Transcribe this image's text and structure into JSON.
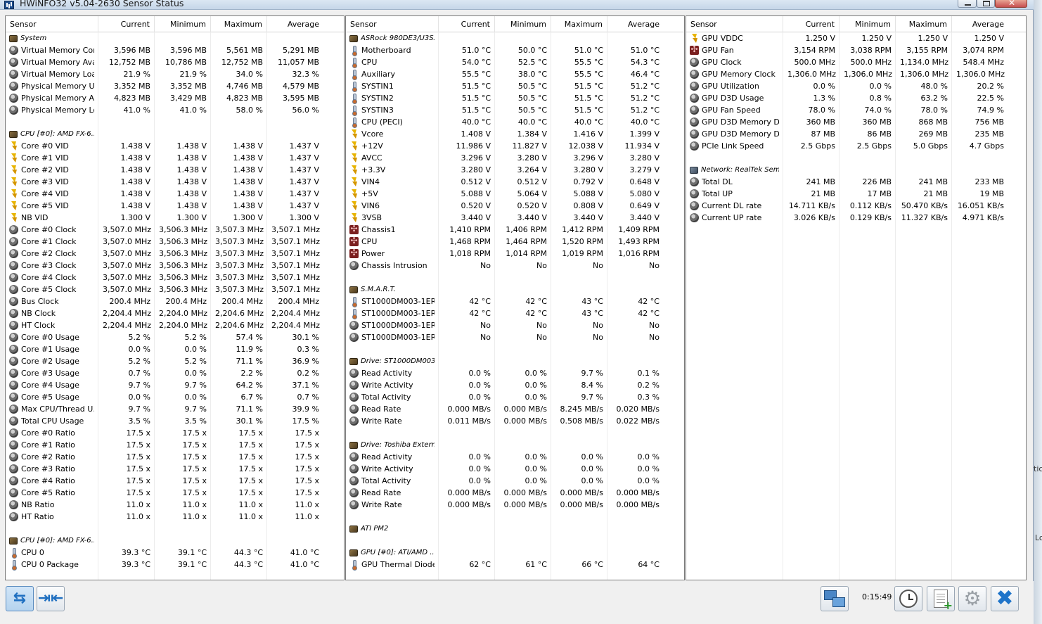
{
  "window": {
    "title": "HWiNFO32 v5.04-2630 Sensor Status"
  },
  "columns": [
    "Sensor",
    "Current",
    "Minimum",
    "Maximum",
    "Average"
  ],
  "panels": [
    {
      "rows": [
        {
          "t": "g",
          "icon": "chip",
          "n": "System"
        },
        {
          "icon": "gauge",
          "n": "Virtual Memory Com...",
          "v": [
            "3,596 MB",
            "3,596 MB",
            "5,561 MB",
            "5,291 MB"
          ]
        },
        {
          "icon": "gauge",
          "n": "Virtual Memory Avai...",
          "v": [
            "12,752 MB",
            "10,786 MB",
            "12,752 MB",
            "11,057 MB"
          ]
        },
        {
          "icon": "gauge",
          "n": "Virtual Memory Load",
          "v": [
            "21.9 %",
            "21.9 %",
            "34.0 %",
            "32.3 %"
          ]
        },
        {
          "icon": "gauge",
          "n": "Physical Memory Used",
          "v": [
            "3,352 MB",
            "3,352 MB",
            "4,746 MB",
            "4,579 MB"
          ]
        },
        {
          "icon": "gauge",
          "n": "Physical Memory Av...",
          "v": [
            "4,823 MB",
            "3,429 MB",
            "4,823 MB",
            "3,595 MB"
          ]
        },
        {
          "icon": "gauge",
          "n": "Physical Memory Load",
          "v": [
            "41.0 %",
            "41.0 %",
            "58.0 %",
            "56.0 %"
          ]
        },
        {
          "t": "b"
        },
        {
          "t": "g",
          "icon": "chip",
          "n": "CPU [#0]: AMD FX-6..."
        },
        {
          "icon": "volt",
          "n": "Core #0 VID",
          "v": [
            "1.438 V",
            "1.438 V",
            "1.438 V",
            "1.437 V"
          ]
        },
        {
          "icon": "volt",
          "n": "Core #1 VID",
          "v": [
            "1.438 V",
            "1.438 V",
            "1.438 V",
            "1.437 V"
          ]
        },
        {
          "icon": "volt",
          "n": "Core #2 VID",
          "v": [
            "1.438 V",
            "1.438 V",
            "1.438 V",
            "1.437 V"
          ]
        },
        {
          "icon": "volt",
          "n": "Core #3 VID",
          "v": [
            "1.438 V",
            "1.438 V",
            "1.438 V",
            "1.437 V"
          ]
        },
        {
          "icon": "volt",
          "n": "Core #4 VID",
          "v": [
            "1.438 V",
            "1.438 V",
            "1.438 V",
            "1.437 V"
          ]
        },
        {
          "icon": "volt",
          "n": "Core #5 VID",
          "v": [
            "1.438 V",
            "1.438 V",
            "1.438 V",
            "1.437 V"
          ]
        },
        {
          "icon": "volt",
          "n": "NB VID",
          "v": [
            "1.300 V",
            "1.300 V",
            "1.300 V",
            "1.300 V"
          ]
        },
        {
          "icon": "gauge",
          "n": "Core #0 Clock",
          "v": [
            "3,507.0 MHz",
            "3,506.3 MHz",
            "3,507.3 MHz",
            "3,507.1 MHz"
          ]
        },
        {
          "icon": "gauge",
          "n": "Core #1 Clock",
          "v": [
            "3,507.0 MHz",
            "3,506.3 MHz",
            "3,507.3 MHz",
            "3,507.1 MHz"
          ]
        },
        {
          "icon": "gauge",
          "n": "Core #2 Clock",
          "v": [
            "3,507.0 MHz",
            "3,506.3 MHz",
            "3,507.3 MHz",
            "3,507.1 MHz"
          ]
        },
        {
          "icon": "gauge",
          "n": "Core #3 Clock",
          "v": [
            "3,507.0 MHz",
            "3,506.3 MHz",
            "3,507.3 MHz",
            "3,507.1 MHz"
          ]
        },
        {
          "icon": "gauge",
          "n": "Core #4 Clock",
          "v": [
            "3,507.0 MHz",
            "3,506.3 MHz",
            "3,507.3 MHz",
            "3,507.1 MHz"
          ]
        },
        {
          "icon": "gauge",
          "n": "Core #5 Clock",
          "v": [
            "3,507.0 MHz",
            "3,506.3 MHz",
            "3,507.3 MHz",
            "3,507.1 MHz"
          ]
        },
        {
          "icon": "gauge",
          "n": "Bus Clock",
          "v": [
            "200.4 MHz",
            "200.4 MHz",
            "200.4 MHz",
            "200.4 MHz"
          ]
        },
        {
          "icon": "gauge",
          "n": "NB Clock",
          "v": [
            "2,204.4 MHz",
            "2,204.0 MHz",
            "2,204.6 MHz",
            "2,204.4 MHz"
          ]
        },
        {
          "icon": "gauge",
          "n": "HT Clock",
          "v": [
            "2,204.4 MHz",
            "2,204.0 MHz",
            "2,204.6 MHz",
            "2,204.4 MHz"
          ]
        },
        {
          "icon": "gauge",
          "n": "Core #0 Usage",
          "v": [
            "5.2 %",
            "5.2 %",
            "57.4 %",
            "30.1 %"
          ]
        },
        {
          "icon": "gauge",
          "n": "Core #1 Usage",
          "v": [
            "0.0 %",
            "0.0 %",
            "11.9 %",
            "0.3 %"
          ]
        },
        {
          "icon": "gauge",
          "n": "Core #2 Usage",
          "v": [
            "5.2 %",
            "5.2 %",
            "71.1 %",
            "36.9 %"
          ]
        },
        {
          "icon": "gauge",
          "n": "Core #3 Usage",
          "v": [
            "0.7 %",
            "0.0 %",
            "2.2 %",
            "0.2 %"
          ]
        },
        {
          "icon": "gauge",
          "n": "Core #4 Usage",
          "v": [
            "9.7 %",
            "9.7 %",
            "64.2 %",
            "37.1 %"
          ]
        },
        {
          "icon": "gauge",
          "n": "Core #5 Usage",
          "v": [
            "0.0 %",
            "0.0 %",
            "6.7 %",
            "0.7 %"
          ]
        },
        {
          "icon": "gauge",
          "n": "Max CPU/Thread U...",
          "v": [
            "9.7 %",
            "9.7 %",
            "71.1 %",
            "39.9 %"
          ]
        },
        {
          "icon": "gauge",
          "n": "Total CPU Usage",
          "v": [
            "3.5 %",
            "3.5 %",
            "30.1 %",
            "17.5 %"
          ]
        },
        {
          "icon": "gauge",
          "n": "Core #0 Ratio",
          "v": [
            "17.5 x",
            "17.5 x",
            "17.5 x",
            "17.5 x"
          ]
        },
        {
          "icon": "gauge",
          "n": "Core #1 Ratio",
          "v": [
            "17.5 x",
            "17.5 x",
            "17.5 x",
            "17.5 x"
          ]
        },
        {
          "icon": "gauge",
          "n": "Core #2 Ratio",
          "v": [
            "17.5 x",
            "17.5 x",
            "17.5 x",
            "17.5 x"
          ]
        },
        {
          "icon": "gauge",
          "n": "Core #3 Ratio",
          "v": [
            "17.5 x",
            "17.5 x",
            "17.5 x",
            "17.5 x"
          ]
        },
        {
          "icon": "gauge",
          "n": "Core #4 Ratio",
          "v": [
            "17.5 x",
            "17.5 x",
            "17.5 x",
            "17.5 x"
          ]
        },
        {
          "icon": "gauge",
          "n": "Core #5 Ratio",
          "v": [
            "17.5 x",
            "17.5 x",
            "17.5 x",
            "17.5 x"
          ]
        },
        {
          "icon": "gauge",
          "n": "NB Ratio",
          "v": [
            "11.0 x",
            "11.0 x",
            "11.0 x",
            "11.0 x"
          ]
        },
        {
          "icon": "gauge",
          "n": "HT Ratio",
          "v": [
            "11.0 x",
            "11.0 x",
            "11.0 x",
            "11.0 x"
          ]
        },
        {
          "t": "b"
        },
        {
          "t": "g",
          "icon": "chip",
          "n": "CPU [#0]: AMD FX-6..."
        },
        {
          "icon": "therm",
          "n": "CPU 0",
          "v": [
            "39.3 °C",
            "39.1 °C",
            "44.3 °C",
            "41.0 °C"
          ]
        },
        {
          "icon": "therm",
          "n": "CPU 0 Package",
          "v": [
            "39.3 °C",
            "39.1 °C",
            "44.3 °C",
            "41.0 °C"
          ]
        }
      ]
    },
    {
      "rows": [
        {
          "t": "g",
          "icon": "chip",
          "n": "ASRock 980DE3/U3S3..."
        },
        {
          "icon": "therm",
          "n": "Motherboard",
          "v": [
            "51.0 °C",
            "50.0 °C",
            "51.0 °C",
            "51.0 °C"
          ]
        },
        {
          "icon": "therm",
          "n": "CPU",
          "v": [
            "54.0 °C",
            "52.5 °C",
            "55.5 °C",
            "54.3 °C"
          ]
        },
        {
          "icon": "therm",
          "n": "Auxiliary",
          "v": [
            "55.5 °C",
            "38.0 °C",
            "55.5 °C",
            "46.4 °C"
          ]
        },
        {
          "icon": "therm",
          "n": "SYSTIN1",
          "v": [
            "51.5 °C",
            "50.5 °C",
            "51.5 °C",
            "51.2 °C"
          ]
        },
        {
          "icon": "therm",
          "n": "SYSTIN2",
          "v": [
            "51.5 °C",
            "50.5 °C",
            "51.5 °C",
            "51.2 °C"
          ]
        },
        {
          "icon": "therm",
          "n": "SYSTIN3",
          "v": [
            "51.5 °C",
            "50.5 °C",
            "51.5 °C",
            "51.2 °C"
          ]
        },
        {
          "icon": "therm",
          "n": "CPU (PECI)",
          "v": [
            "40.0 °C",
            "40.0 °C",
            "40.0 °C",
            "40.0 °C"
          ]
        },
        {
          "icon": "volt",
          "n": "Vcore",
          "v": [
            "1.408 V",
            "1.384 V",
            "1.416 V",
            "1.399 V"
          ]
        },
        {
          "icon": "volt",
          "n": "+12V",
          "v": [
            "11.986 V",
            "11.827 V",
            "12.038 V",
            "11.934 V"
          ]
        },
        {
          "icon": "volt",
          "n": "AVCC",
          "v": [
            "3.296 V",
            "3.280 V",
            "3.296 V",
            "3.280 V"
          ]
        },
        {
          "icon": "volt",
          "n": "+3.3V",
          "v": [
            "3.280 V",
            "3.264 V",
            "3.280 V",
            "3.279 V"
          ]
        },
        {
          "icon": "volt",
          "n": "VIN4",
          "v": [
            "0.512 V",
            "0.512 V",
            "0.792 V",
            "0.648 V"
          ]
        },
        {
          "icon": "volt",
          "n": "+5V",
          "v": [
            "5.088 V",
            "5.064 V",
            "5.088 V",
            "5.080 V"
          ]
        },
        {
          "icon": "volt",
          "n": "VIN6",
          "v": [
            "0.520 V",
            "0.520 V",
            "0.808 V",
            "0.649 V"
          ]
        },
        {
          "icon": "volt",
          "n": "3VSB",
          "v": [
            "3.440 V",
            "3.440 V",
            "3.440 V",
            "3.440 V"
          ]
        },
        {
          "icon": "fan",
          "n": "Chassis1",
          "v": [
            "1,410 RPM",
            "1,406 RPM",
            "1,412 RPM",
            "1,409 RPM"
          ]
        },
        {
          "icon": "fan",
          "n": "CPU",
          "v": [
            "1,468 RPM",
            "1,464 RPM",
            "1,520 RPM",
            "1,493 RPM"
          ]
        },
        {
          "icon": "fan",
          "n": "Power",
          "v": [
            "1,018 RPM",
            "1,014 RPM",
            "1,019 RPM",
            "1,016 RPM"
          ]
        },
        {
          "icon": "gauge",
          "n": "Chassis Intrusion",
          "v": [
            "No",
            "No",
            "No",
            "No"
          ]
        },
        {
          "t": "b"
        },
        {
          "t": "g",
          "icon": "chip",
          "n": "S.M.A.R.T."
        },
        {
          "icon": "therm",
          "n": "ST1000DM003-1ER1...",
          "v": [
            "42 °C",
            "42 °C",
            "43 °C",
            "42 °C"
          ]
        },
        {
          "icon": "therm",
          "n": "ST1000DM003-1ER1...",
          "v": [
            "42 °C",
            "42 °C",
            "43 °C",
            "42 °C"
          ]
        },
        {
          "icon": "gauge",
          "n": "ST1000DM003-1ER1...",
          "v": [
            "No",
            "No",
            "No",
            "No"
          ]
        },
        {
          "icon": "gauge",
          "n": "ST1000DM003-1ER1...",
          "v": [
            "No",
            "No",
            "No",
            "No"
          ]
        },
        {
          "t": "b"
        },
        {
          "t": "g",
          "icon": "chip",
          "n": "Drive: ST1000DM003-..."
        },
        {
          "icon": "gauge",
          "n": "Read Activity",
          "v": [
            "0.0 %",
            "0.0 %",
            "9.7 %",
            "0.1 %"
          ]
        },
        {
          "icon": "gauge",
          "n": "Write Activity",
          "v": [
            "0.0 %",
            "0.0 %",
            "8.4 %",
            "0.2 %"
          ]
        },
        {
          "icon": "gauge",
          "n": "Total Activity",
          "v": [
            "0.0 %",
            "0.0 %",
            "9.7 %",
            "0.3 %"
          ]
        },
        {
          "icon": "gauge",
          "n": "Read Rate",
          "v": [
            "0.000 MB/s",
            "0.000 MB/s",
            "8.245 MB/s",
            "0.020 MB/s"
          ]
        },
        {
          "icon": "gauge",
          "n": "Write Rate",
          "v": [
            "0.011 MB/s",
            "0.000 MB/s",
            "0.508 MB/s",
            "0.022 MB/s"
          ]
        },
        {
          "t": "b"
        },
        {
          "t": "g",
          "icon": "chip",
          "n": "Drive: Toshiba Extern..."
        },
        {
          "icon": "gauge",
          "n": "Read Activity",
          "v": [
            "0.0 %",
            "0.0 %",
            "0.0 %",
            "0.0 %"
          ]
        },
        {
          "icon": "gauge",
          "n": "Write Activity",
          "v": [
            "0.0 %",
            "0.0 %",
            "0.0 %",
            "0.0 %"
          ]
        },
        {
          "icon": "gauge",
          "n": "Total Activity",
          "v": [
            "0.0 %",
            "0.0 %",
            "0.0 %",
            "0.0 %"
          ]
        },
        {
          "icon": "gauge",
          "n": "Read Rate",
          "v": [
            "0.000 MB/s",
            "0.000 MB/s",
            "0.000 MB/s",
            "0.000 MB/s"
          ]
        },
        {
          "icon": "gauge",
          "n": "Write Rate",
          "v": [
            "0.000 MB/s",
            "0.000 MB/s",
            "0.000 MB/s",
            "0.000 MB/s"
          ]
        },
        {
          "t": "b"
        },
        {
          "t": "g",
          "icon": "chip",
          "n": "ATI PM2"
        },
        {
          "t": "b"
        },
        {
          "t": "g",
          "icon": "chip",
          "n": "GPU [#0]: ATI/AMD ..."
        },
        {
          "icon": "therm",
          "n": "GPU Thermal Diode",
          "v": [
            "62 °C",
            "61 °C",
            "66 °C",
            "64 °C"
          ]
        }
      ]
    },
    {
      "rows": [
        {
          "icon": "volt",
          "n": "GPU VDDC",
          "v": [
            "1.250 V",
            "1.250 V",
            "1.250 V",
            "1.250 V"
          ]
        },
        {
          "icon": "fan",
          "n": "GPU Fan",
          "v": [
            "3,154 RPM",
            "3,038 RPM",
            "3,155 RPM",
            "3,074 RPM"
          ]
        },
        {
          "icon": "gauge",
          "n": "GPU Clock",
          "v": [
            "500.0 MHz",
            "500.0 MHz",
            "1,134.0 MHz",
            "548.4 MHz"
          ]
        },
        {
          "icon": "gauge",
          "n": "GPU Memory Clock",
          "v": [
            "1,306.0 MHz",
            "1,306.0 MHz",
            "1,306.0 MHz",
            "1,306.0 MHz"
          ]
        },
        {
          "icon": "gauge",
          "n": "GPU Utilization",
          "v": [
            "0.0 %",
            "0.0 %",
            "48.0 %",
            "20.2 %"
          ]
        },
        {
          "icon": "gauge",
          "n": "GPU D3D Usage",
          "v": [
            "1.3 %",
            "0.8 %",
            "63.2 %",
            "22.5 %"
          ]
        },
        {
          "icon": "gauge",
          "n": "GPU Fan Speed",
          "v": [
            "78.0 %",
            "74.0 %",
            "78.0 %",
            "74.9 %"
          ]
        },
        {
          "icon": "gauge",
          "n": "GPU D3D Memory De...",
          "v": [
            "360 MB",
            "360 MB",
            "868 MB",
            "756 MB"
          ]
        },
        {
          "icon": "gauge",
          "n": "GPU D3D Memory Dy...",
          "v": [
            "87 MB",
            "86 MB",
            "269 MB",
            "235 MB"
          ]
        },
        {
          "icon": "gauge",
          "n": "PCIe Link Speed",
          "v": [
            "2.5 Gbps",
            "2.5 Gbps",
            "5.0 Gbps",
            "4.7 Gbps"
          ]
        },
        {
          "t": "b"
        },
        {
          "t": "g",
          "icon": "net",
          "n": "Network: RealTek Semi..."
        },
        {
          "icon": "gauge",
          "n": "Total DL",
          "v": [
            "241 MB",
            "226 MB",
            "241 MB",
            "233 MB"
          ]
        },
        {
          "icon": "gauge",
          "n": "Total UP",
          "v": [
            "21 MB",
            "17 MB",
            "21 MB",
            "19 MB"
          ]
        },
        {
          "icon": "gauge",
          "n": "Current DL rate",
          "v": [
            "14.711 KB/s",
            "0.112 KB/s",
            "50.470 KB/s",
            "16.051 KB/s"
          ]
        },
        {
          "icon": "gauge",
          "n": "Current UP rate",
          "v": [
            "3.026 KB/s",
            "0.129 KB/s",
            "11.327 KB/s",
            "4.971 KB/s"
          ]
        }
      ]
    }
  ],
  "toolbar": {
    "elapsed": "0:15:49",
    "expand_icon": "expand-arrows-icon",
    "collapse_icon": "collapse-arrows-icon",
    "network_icon": "network-icon",
    "clock_icon": "clock-icon",
    "report_icon": "report-icon",
    "settings_icon": "gear-icon",
    "exit_icon": "close-icon"
  },
  "background": {
    "text_1": "tic",
    "text_2": "Lo"
  },
  "colors": {
    "accent": "#1f74c9",
    "panel_bg": "#ffffff",
    "window_bg": "#f0f0f0"
  }
}
